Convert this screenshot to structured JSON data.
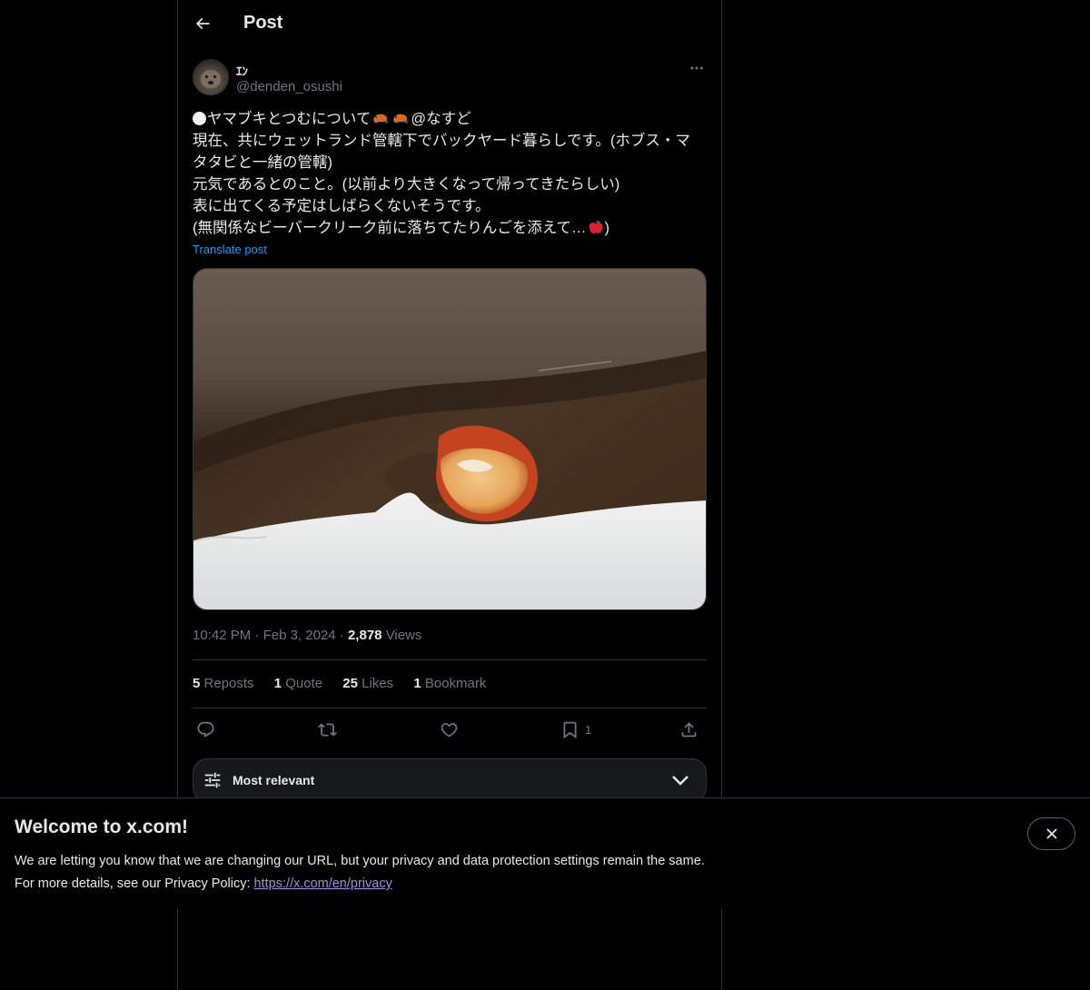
{
  "header": {
    "title": "Post",
    "back_icon": "arrow-left-icon"
  },
  "author": {
    "display_name": "ｴﾝ",
    "handle": "@denden_osushi"
  },
  "post": {
    "lines": [
      "ヤマブキとつむについて",
      "@なすど",
      "現在、共にウェットランド管轄下でバックヤード暮らしです。(ホブス・マ",
      "タタビと一緒の管轄)",
      "元気であるとのこと。(以前より大きくなって帰ってきたらしい)",
      "表に出てくる予定はしばらくないそうです。",
      "(無関係なビーバークリーク前に落ちてたりんごを添えて…",
      ")"
    ],
    "emojis": [
      "white-circle",
      "shrimp",
      "shrimp",
      "red-apple"
    ],
    "translate_label": "Translate post"
  },
  "media": {
    "subject": "half apple on snow beside rock",
    "icon": "photo"
  },
  "meta": {
    "time": "10:42 PM",
    "separator": "·",
    "date": "Feb 3, 2024",
    "views_count": "2,878",
    "views_label": "Views"
  },
  "stats": {
    "reposts_count": "5",
    "reposts_label": "Reposts",
    "quotes_count": "1",
    "quotes_label": "Quote",
    "likes_count": "25",
    "likes_label": "Likes",
    "bookmarks_count": "1",
    "bookmarks_label": "Bookmark"
  },
  "actions": {
    "bookmark_count": "1",
    "icons": [
      "reply-icon",
      "repost-icon",
      "like-icon",
      "bookmark-icon",
      "share-icon"
    ]
  },
  "sort": {
    "label": "Most relevant"
  },
  "banner": {
    "title": "Welcome to x.com!",
    "line1": "We are letting you know that we are changing our URL, but your privacy and data protection settings remain the same.",
    "line2_prefix": "For more details, see our Privacy Policy: ",
    "link": "https://x.com/en/privacy"
  },
  "colors": {
    "background": "#000000",
    "text": "#e7e9ea",
    "muted": "#71767b",
    "accent": "#1d9bf0",
    "border": "#2f3336"
  }
}
